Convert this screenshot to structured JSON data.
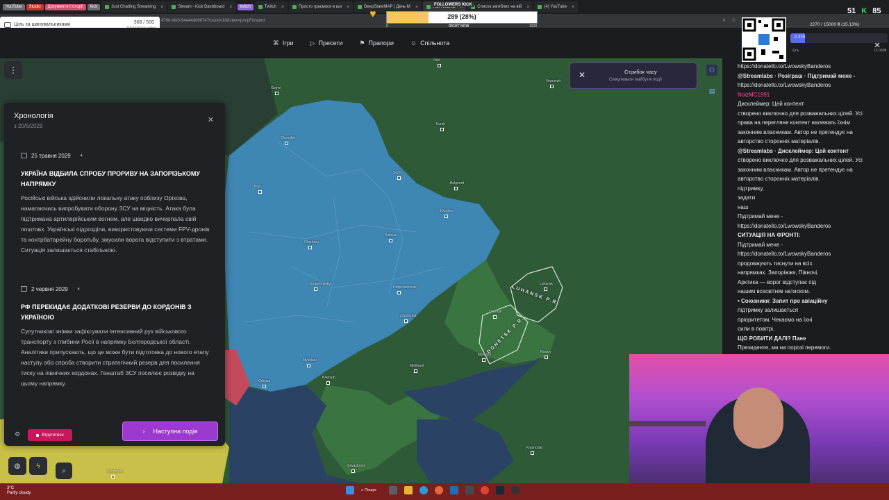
{
  "browser": {
    "tabs": [
      {
        "label": "YouTube",
        "type": "chip"
      },
      {
        "label": "Studio",
        "type": "chip red"
      },
      {
        "label": "Документи і історії",
        "type": "chip pink"
      },
      {
        "label": "kick",
        "type": "chip"
      },
      {
        "label": "Just Chatting Streaming",
        "type": "tab"
      },
      {
        "label": "Stream - Kick Dashboard",
        "type": "tab"
      },
      {
        "label": "twitch",
        "type": "chip purple"
      },
      {
        "label": "Twitch",
        "type": "tab"
      },
      {
        "label": "Просто граємося в ши",
        "type": "tab"
      },
      {
        "label": "DeepStateMAP | День М",
        "type": "tab"
      },
      {
        "label": "Pax Historia",
        "type": "tab active"
      },
      {
        "label": "Список загиблих на вій",
        "type": "tab"
      },
      {
        "label": "(4) YouTube",
        "type": "tab"
      }
    ],
    "url": "4796-bfe3-94a44d686747round=16&view=jumpForward"
  },
  "site_nav": {
    "items": [
      {
        "icon": "gamepad-icon",
        "glyph": "⌘",
        "label": "Ігри"
      },
      {
        "icon": "play-icon",
        "glyph": "▷",
        "label": "Пресети"
      },
      {
        "icon": "flag-icon",
        "glyph": "⚑",
        "label": "Прапори"
      },
      {
        "icon": "users-icon",
        "glyph": "☺",
        "label": "Спільнота"
      }
    ]
  },
  "timeline": {
    "title": "Хронологія",
    "subtitle": "з 20/5/2029",
    "events": [
      {
        "date": "25 травня 2029",
        "headline": "УКРАЇНА ВІДБИЛА СПРОБУ ПРОРИВУ НА ЗАПОРІЗЬКОМУ НАПРЯМКУ",
        "body": "Російські війська здійснили локальну атаку поблизу Оріхова, намагаючись випробувати оборону ЗСУ на міцність. Атака була підтримана артилерійським вогнем, але швидко вичерпала свій поштовх. Українські підрозділи, використовуючи системи FPV-дронів та контрбатарейну боротьбу, змусили ворога відступити з втратами. Ситуація залишається стабільною."
      },
      {
        "date": "2 червня 2029",
        "headline": "РФ ПЕРЕКИДАЄ ДОДАТКОВІ РЕЗЕРВИ ДО КОРДОНІВ З УКРАЇНОЮ",
        "body": "Супутникові знімки зафіксували інтенсивний рух військового транспорту з глибини Росії в напрямку Бєлгородської області. Аналітики припускають, що це може бути підготовка до нового етапу наступу або спроба створити стратегічний резерв для посилення тиску на північних кордонах. Генштаб ЗСУ посилює розвідку на цьому напрямку."
      }
    ],
    "join_label": "Втрутитися",
    "next_label": "Наступна подія"
  },
  "time_jump": {
    "title": "Стрибок часу",
    "subtitle": "Симулювати майбутні події"
  },
  "map": {
    "colors": {
      "ukraine": "#3e86b3",
      "russia": "#2c5836",
      "occupied": "#3a7440",
      "sea": "#2a4364",
      "romania": "#c9c04a"
    },
    "cities": [
      {
        "name": "Orel",
        "cls": "c1"
      },
      {
        "name": "Kursk",
        "cls": "c2"
      },
      {
        "name": "Gomel",
        "cls": "c3"
      },
      {
        "name": "Chernihiv",
        "cls": "c4"
      },
      {
        "name": "Kiev",
        "cls": "c5"
      },
      {
        "name": "Sumy",
        "cls": "c6"
      },
      {
        "name": "Belgorod",
        "cls": "c7"
      },
      {
        "name": "Kharkov",
        "cls": "c8"
      },
      {
        "name": "Poltava",
        "cls": "c9"
      },
      {
        "name": "Cherkasy",
        "cls": "c10"
      },
      {
        "name": "Kropyvnytskyi",
        "cls": "c11"
      },
      {
        "name": "Dnipropetrovsk",
        "cls": "c12"
      },
      {
        "name": "Zaporizhia",
        "cls": "c13"
      },
      {
        "name": "Donetsk",
        "cls": "c14"
      },
      {
        "name": "Luhansk",
        "cls": "c15"
      },
      {
        "name": "Mykolaiv",
        "cls": "c16"
      },
      {
        "name": "Odessa",
        "cls": "c17"
      },
      {
        "name": "Kherson",
        "cls": "c18"
      },
      {
        "name": "Melitopol",
        "cls": "c19"
      },
      {
        "name": "Mariupol",
        "cls": "c20"
      },
      {
        "name": "Krasnodar",
        "cls": "c21"
      },
      {
        "name": "Sevastopol",
        "cls": "c22"
      },
      {
        "name": "Bucharest",
        "cls": "c23"
      },
      {
        "name": "Voronezh",
        "cls": "c24"
      },
      {
        "name": "Rostov",
        "cls": "c25"
      }
    ],
    "regions": {
      "luhansk": "LUHANSK P.R.",
      "donetsk": "DONETSK P.R."
    }
  },
  "overlay": {
    "goal_left_title": "Ціль за шанувальниками",
    "goal_left_value": "368 / 500",
    "goal_left_unit": "Шанувальники",
    "goal_left_progress": 0.736,
    "followers_label": "FOLLOWERS KICK",
    "followers_value": "289 (28%)",
    "followers_progress": 0.28,
    "followers_min": "0",
    "followers_mid": "RIGHT NOW",
    "followers_max": "1000",
    "donation_text": "2270 / 15000 ₴ (15.13%)",
    "donation_amount": "2 270",
    "donation_low": "Ціль",
    "donation_high": "15 000₴",
    "donation_progress": 0.1513,
    "count_a": "51",
    "count_b": "85"
  },
  "chat": {
    "lines": [
      {
        "text": "https://donatello.to/LwowskyBanderos",
        "cls": ""
      },
      {
        "text": "@Streamlabs · Розіграш · Підтримай мене -",
        "cls": "bold"
      },
      {
        "text": "https://donatello.to/LwowskyBanderos",
        "cls": ""
      },
      {
        "text": "NoizMC1991",
        "cls": "name"
      },
      {
        "text": "Дисклеймер: Цей контент",
        "cls": ""
      },
      {
        "text": "створено виключно для розважальних цілей. Усі",
        "cls": ""
      },
      {
        "text": "права на перегляне контент належать їхнім",
        "cls": ""
      },
      {
        "text": "законним власникам. Автор не претендує на",
        "cls": ""
      },
      {
        "text": "авторство сторонніх матеріалів.",
        "cls": ""
      },
      {
        "text": "@Streamlabs · Дисклеймер: Цей контент",
        "cls": "bold"
      },
      {
        "text": "створено виключно для розважальних цілей. Усі",
        "cls": ""
      },
      {
        "text": "законним власникам. Автор не претендує на",
        "cls": ""
      },
      {
        "text": "авторство сторонніх матеріалів.",
        "cls": ""
      },
      {
        "text": "підтримку,",
        "cls": ""
      },
      {
        "text": "задати",
        "cls": ""
      },
      {
        "text": "наш",
        "cls": ""
      },
      {
        "text": "Підтримай мене -",
        "cls": ""
      },
      {
        "text": "https://donatello.to/LwowskyBanderos",
        "cls": ""
      },
      {
        "text": "СИТУАЦІЯ НА ФРОНТІ:",
        "cls": "bold"
      },
      {
        "text": "Підтримай мене -",
        "cls": ""
      },
      {
        "text": "https://donatello.to/LwowskyBanderos",
        "cls": ""
      },
      {
        "text": "продовжують тиснути на всіх",
        "cls": ""
      },
      {
        "text": "напрямках. Запоріжжя, Півночі,",
        "cls": ""
      },
      {
        "text": "Арктика — ворог відступає під",
        "cls": ""
      },
      {
        "text": "нашим всесвітнім натиском.",
        "cls": ""
      },
      {
        "text": "• Союзники: Запит про авіаційну",
        "cls": "bold"
      },
      {
        "text": "підтримку залишається",
        "cls": ""
      },
      {
        "text": "пріоритетом. Чекаємо на їхні",
        "cls": ""
      },
      {
        "text": "сили в повітрі.",
        "cls": ""
      },
      {
        "text": "ЩО РОБИТИ ДАЛІ? Пане",
        "cls": "bold"
      },
      {
        "text": "Президенте, ми на порозі перемоги.",
        "cls": ""
      }
    ]
  },
  "taskbar": {
    "weather_temp": "3°C",
    "weather_desc": "Partly cloudy",
    "search_label": "Пошук"
  }
}
